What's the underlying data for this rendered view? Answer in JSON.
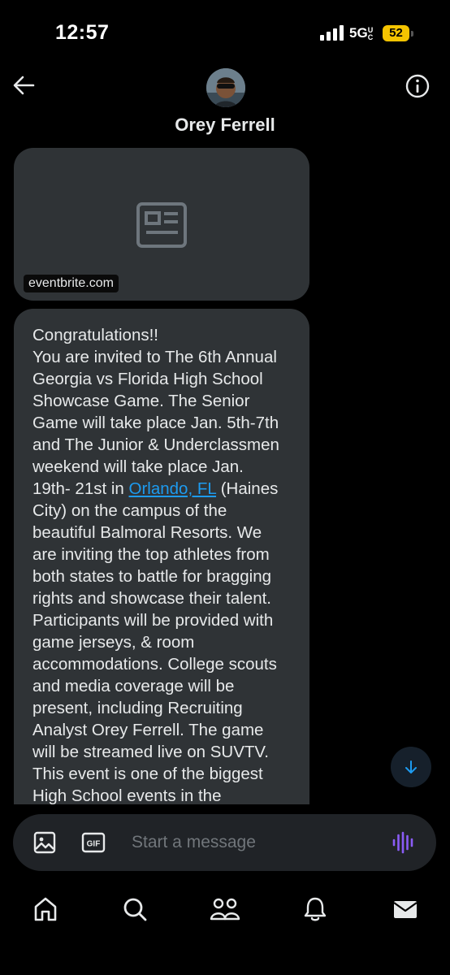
{
  "status_bar": {
    "time": "12:57",
    "network": "5G",
    "network_suffix": "UC",
    "battery": "52",
    "battery_color": "#f5c400"
  },
  "header": {
    "back_icon": "arrow-left-icon",
    "contact_name": "Orey Ferrell",
    "info_icon": "info-icon"
  },
  "link_card": {
    "icon": "article-icon",
    "domain": "eventbrite.com"
  },
  "message": {
    "lines": [
      "Congratulations!!",
      "You are invited to The 6th Annual",
      "Georgia vs Florida High School",
      "Showcase Game. The Senior",
      "Game will take place Jan. 5th-7th",
      "and The Junior & Underclassmen",
      "weekend will take place Jan."
    ],
    "link_line_prefix": "19th- 21st in ",
    "link_text": "Orlando, FL",
    "link_line_suffix": " (Haines",
    "lines_after": [
      "City) on the campus of the",
      "beautiful Balmoral Resorts. We",
      "are inviting the top athletes from",
      "both states to battle for bragging",
      "rights and showcase their talent.",
      "Participants will be provided with",
      "game jerseys, & room",
      "accommodations. College scouts",
      "and media coverage will be",
      "present, including Recruiting",
      "Analyst Orey Ferrell. The game",
      "will be streamed live on SUVTV.",
      "This event is one of the biggest",
      "High School events in the"
    ],
    "link_color": "#1d9bf0"
  },
  "scroll_down": {
    "icon": "arrow-down-icon",
    "color": "#1d9bf0"
  },
  "composer": {
    "image_icon": "image-icon",
    "gif_label": "GIF",
    "placeholder": "Start a message",
    "voice_icon": "voice-waveform-icon",
    "voice_color": "#8a5cf6"
  },
  "tabs": [
    "home-icon",
    "search-icon",
    "communities-icon",
    "notifications-icon",
    "messages-icon"
  ]
}
